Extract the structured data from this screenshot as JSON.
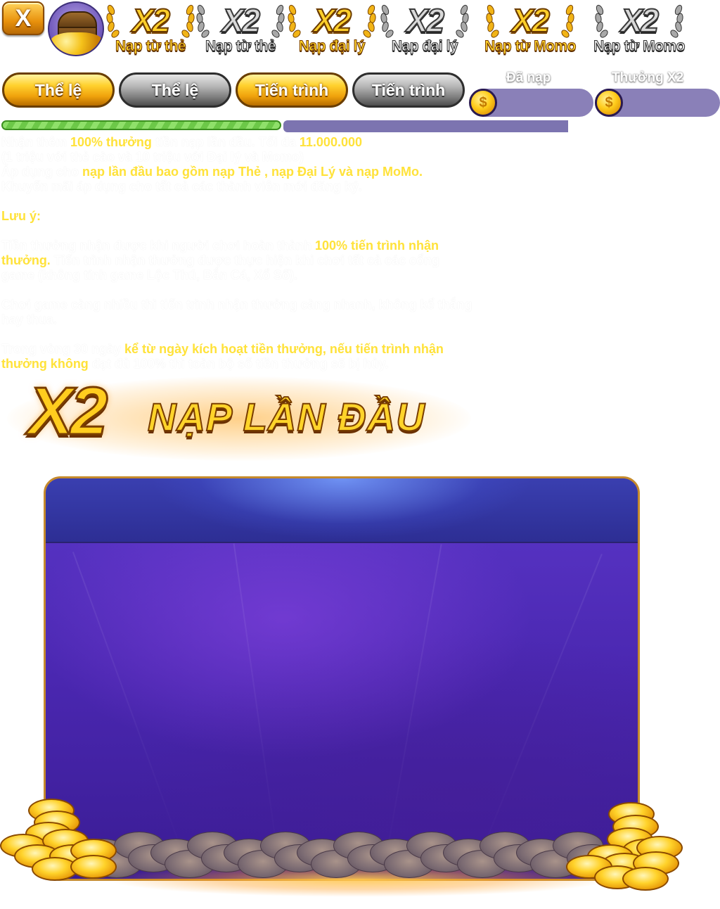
{
  "close_button": {
    "label": "X"
  },
  "tiers": [
    {
      "multiplier": "X2",
      "caption": "Nạp từ thẻ",
      "style": "gold"
    },
    {
      "multiplier": "X2",
      "caption": "Nạp từ thẻ",
      "style": "gray"
    },
    {
      "multiplier": "X2",
      "caption": "Nạp đại lý",
      "style": "gold"
    },
    {
      "multiplier": "X2",
      "caption": "Nạp đại lý",
      "style": "gray"
    },
    {
      "multiplier": "X2",
      "caption": "Nạp từ Momo",
      "style": "gold"
    },
    {
      "multiplier": "X2",
      "caption": "Nạp từ Momo",
      "style": "gray"
    }
  ],
  "tabs": [
    {
      "label": "Thể lệ",
      "style": "gold"
    },
    {
      "label": "Thể lệ",
      "style": "gray"
    },
    {
      "label": "Tiến trình",
      "style": "gold"
    },
    {
      "label": "Tiến trình",
      "style": "gray"
    }
  ],
  "stats": {
    "deposited_label": "Đã nạp",
    "bonus_label": "Thưởng X2",
    "coin_symbol": "$"
  },
  "progress": {
    "fraction": 0.5
  },
  "rules": {
    "line1_a": "Nhận thêm ",
    "line1_hl": "100% thưởng",
    "line1_b": " tiền nạp lần đầu. Tối đa ",
    "line1_hl2": "11.000.000",
    "line2": "(1 triệu với thẻ cào và 10 triệu với Đại lý và Momo)",
    "line3_a": "Áp dụng cho ",
    "line3_hl": "nạp lần đầu bao gồm nạp Thẻ , nạp Đại Lý và nạp MoMo.",
    "line4": "Khuyến mãi áp dụng cho tất cả các thành viên mới đăng ký.",
    "note_label": "Lưu ý:",
    "p1_a": "Tiền thưởng nhận được khi người chơi hoàn thành ",
    "p1_hl": "100% tiến trình nhận thưởng.",
    "p1_b": " Tiến trình nhận thưởng được thực hiện khi chơi tất cả các cổng game (không tính game Lộc Thú, Bắn Cá, Xổ Số).",
    "p2": "Chơi game càng nhiều thì tiến trình nhận thưởng càng nhanh, không kể thắng hay thua.",
    "p3_a": "Trong vòng 30 ngày ",
    "p3_hl": "kể từ ngày kích hoạt tiền thưởng, nếu tiến trình nhận thưởng không",
    "p3_b": " đạt đủ 100% thì toàn bộ số tiền thưởng sẽ bị hủy."
  },
  "banner": {
    "multiplier": "X2",
    "title": "NẠP LẦN ĐẦU"
  }
}
